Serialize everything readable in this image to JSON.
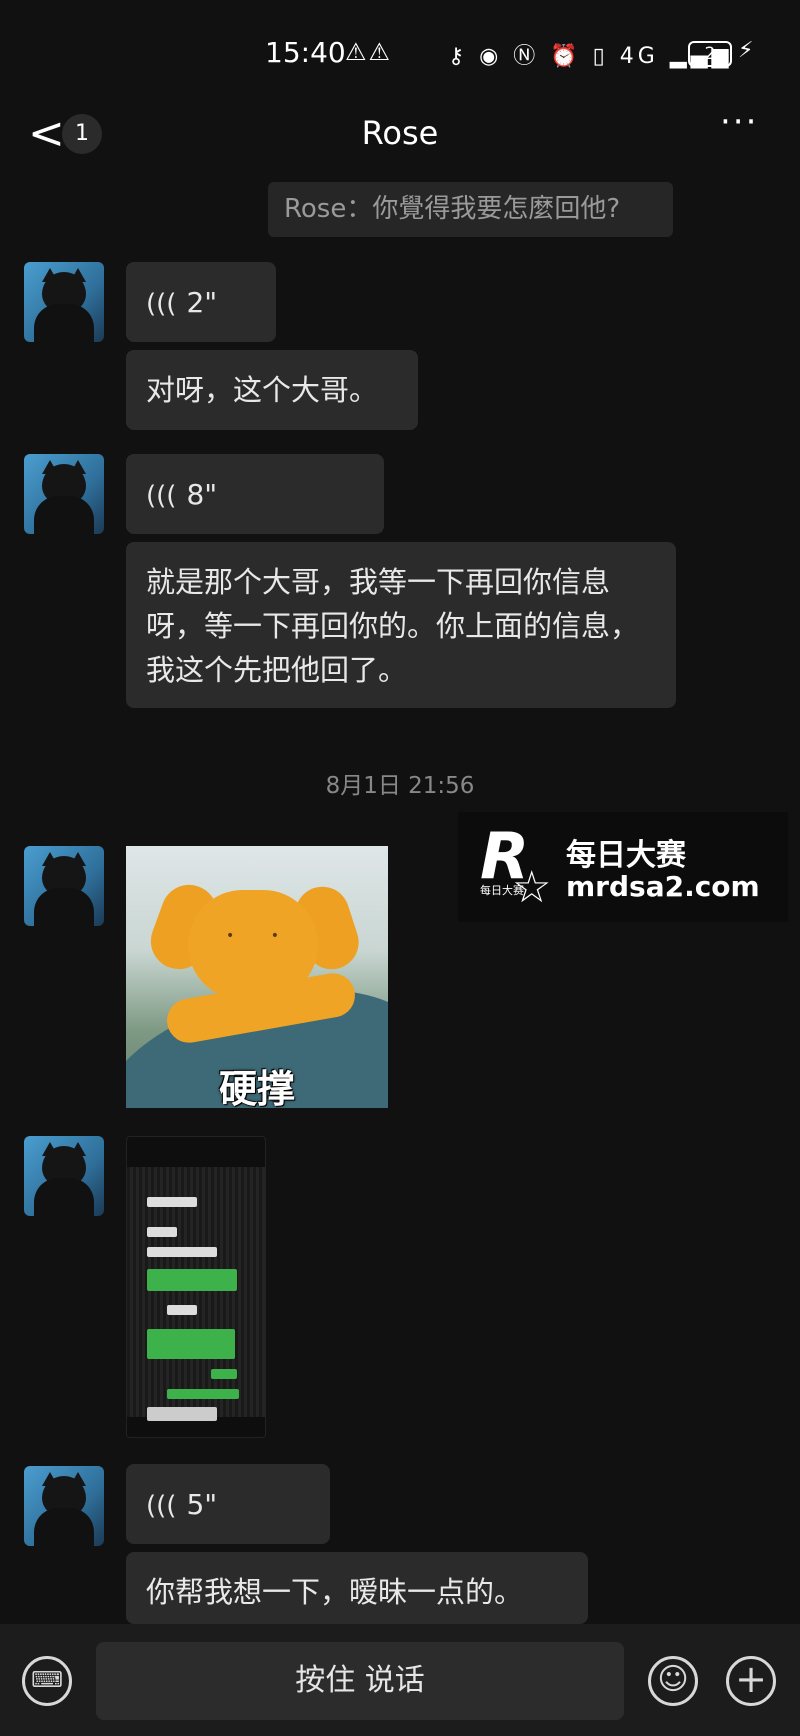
{
  "status_bar": {
    "time": "15:40",
    "warning_icons": "⚠⚠",
    "right_icons": "⚷ ◉ Ⓝ ⏰ ▯ 4G ▂▄▆",
    "battery": "2",
    "charging": "⚡"
  },
  "header": {
    "back": "<",
    "unread_count": "1",
    "title": "Rose",
    "more": "···"
  },
  "messages": {
    "quote": "Rose：你覺得我要怎麼回他?",
    "voice1": "2\"",
    "text1": "对呀，这个大哥。",
    "voice2": "8\"",
    "text2": "就是那个大哥，我等一下再回你信息呀，等一下再回你的。你上面的信息，我这个先把他回了。",
    "timestamp": "8月1日 21:56",
    "sticker_caption": "硬撑",
    "voice3": "5\"",
    "text3": "你帮我想一下，暧昧一点的。"
  },
  "watermark": {
    "title": "每日大赛",
    "url": "mrdsa2.com",
    "logo_letter": "R",
    "logo_small": "每日大赛"
  },
  "input_bar": {
    "hold_to_talk": "按住 说话"
  },
  "icons": {
    "voice": "(((",
    "keyboard": "⌨",
    "emoji": "☺",
    "plus": "+"
  },
  "colors": {
    "background": "#111111",
    "bubble": "#2b2b2b",
    "thumb_green": "#3db24a"
  }
}
